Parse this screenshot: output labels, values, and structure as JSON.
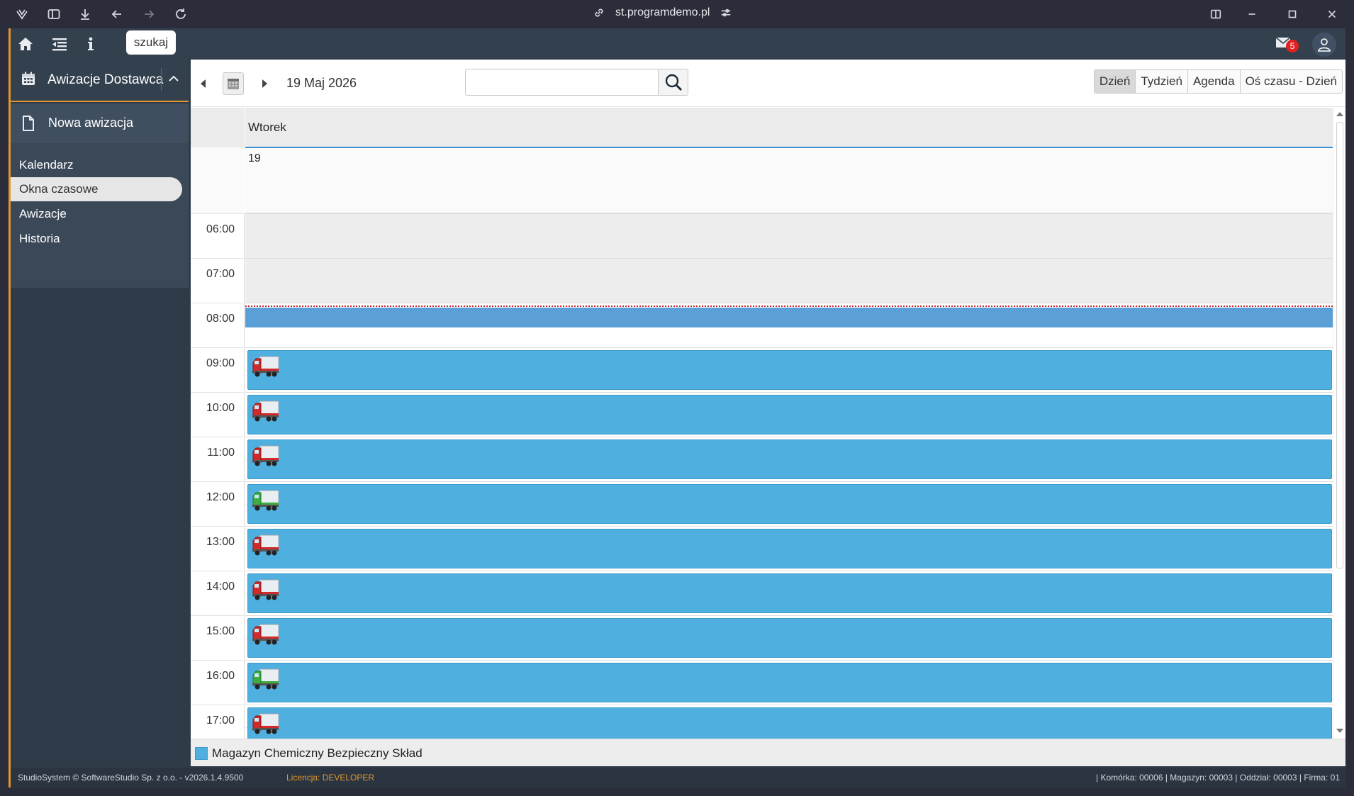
{
  "browser": {
    "url": "st.programdemo.pl"
  },
  "topbar": {
    "search_label": "szukaj",
    "mail_count": "5"
  },
  "sidebar": {
    "module_title": "Awizacje Dostawca",
    "new_item_label": "Nowa awizacja",
    "items": [
      {
        "label": "Kalendarz",
        "active": false
      },
      {
        "label": "Okna czasowe",
        "active": true
      },
      {
        "label": "Awizacje",
        "active": false
      },
      {
        "label": "Historia",
        "active": false
      }
    ]
  },
  "toolbar": {
    "date": "19 Maj 2026",
    "search_value": "",
    "views": [
      "Dzień",
      "Tydzień",
      "Agenda",
      "Oś czasu - Dzień"
    ],
    "selected_view": "Dzień"
  },
  "scheduler": {
    "day_name": "Wtorek",
    "day_number": "19",
    "hours": [
      "06:00",
      "07:00",
      "08:00",
      "09:00",
      "10:00",
      "11:00",
      "12:00",
      "13:00",
      "14:00",
      "15:00",
      "16:00",
      "17:00"
    ],
    "slots": [
      {
        "start": "09:00",
        "truck": "red"
      },
      {
        "start": "10:00",
        "truck": "red"
      },
      {
        "start": "11:00",
        "truck": "red"
      },
      {
        "start": "12:00",
        "truck": "green"
      },
      {
        "start": "13:00",
        "truck": "red"
      },
      {
        "start": "14:00",
        "truck": "red"
      },
      {
        "start": "15:00",
        "truck": "red"
      },
      {
        "start": "16:00",
        "truck": "green"
      },
      {
        "start": "17:00",
        "truck": "red"
      }
    ],
    "colors": {
      "slot": "#4fb0e0",
      "now_block": "#5a9fd6",
      "now_line": "#c8202a"
    }
  },
  "legend": {
    "label": "Magazyn Chemiczny Bezpieczny Skład"
  },
  "footer": {
    "copyright": "StudioSystem © SoftwareStudio Sp. z o.o. - v2026.1.4.9500",
    "license_prefix": "Licencja: ",
    "license_value": "DEVELOPER",
    "context": "| Komórka: 00006 | Magazyn: 00003 | Oddział: 00003 | Firma: 01"
  }
}
